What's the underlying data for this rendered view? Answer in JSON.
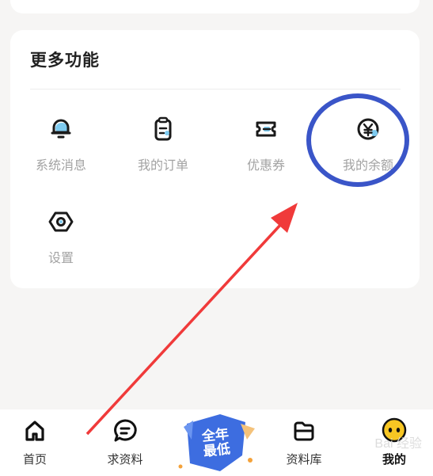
{
  "more_functions": {
    "title": "更多功能",
    "items": [
      {
        "label": "系统消息",
        "icon": "bell-icon"
      },
      {
        "label": "我的订单",
        "icon": "clipboard-icon"
      },
      {
        "label": "优惠券",
        "icon": "ticket-icon"
      },
      {
        "label": "我的余额",
        "icon": "yen-coin-icon"
      },
      {
        "label": "设置",
        "icon": "hexagon-nut-icon"
      }
    ]
  },
  "tabbar": {
    "items": [
      {
        "label": "首页",
        "icon": "home-icon"
      },
      {
        "label": "求资料",
        "icon": "chat-bubble-icon"
      },
      {
        "label": "资料库",
        "icon": "folder-icon"
      },
      {
        "label": "我的",
        "icon": "profile-face-icon",
        "active": true
      }
    ],
    "promo": {
      "line1": "全年",
      "line2": "最低"
    }
  },
  "watermark": "Bai 经验",
  "colors": {
    "accent_blue": "#7ecbf0",
    "annotation_circle": "#3a55c8",
    "annotation_arrow": "#f03a3a",
    "promo_blue": "#3d6de0",
    "active_face": "#f7c623"
  }
}
